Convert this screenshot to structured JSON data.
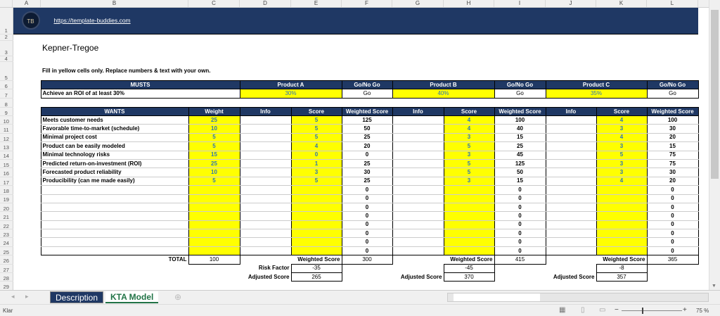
{
  "columns": [
    "A",
    "B",
    "C",
    "D",
    "E",
    "F",
    "G",
    "H",
    "I",
    "J",
    "K",
    "L"
  ],
  "header": {
    "link": "https://template-buddies.com",
    "logo_text": "TB"
  },
  "title": "Kepner-Tregoe",
  "note": "Fill in yellow cells only. Replace numbers & text with your own.",
  "musts": {
    "header": "MUSTS",
    "go_label": "Go/No Go",
    "products": [
      "Product A",
      "Product B",
      "Product C"
    ],
    "criterion": "Achieve an ROI of at least 30%",
    "values": [
      "30%",
      "40%",
      "35%"
    ],
    "go": [
      "Go",
      "Go",
      "Go"
    ]
  },
  "wants": {
    "headers": [
      "WANTS",
      "Weight",
      "Info",
      "Score",
      "Weighted Score"
    ],
    "rows": [
      {
        "name": "Meets customer needs",
        "weight": "25",
        "scores": [
          "5",
          "4",
          "4"
        ],
        "weighted": [
          "125",
          "100",
          "100"
        ]
      },
      {
        "name": "Favorable time-to-market (schedule)",
        "weight": "10",
        "scores": [
          "5",
          "4",
          "3"
        ],
        "weighted": [
          "50",
          "40",
          "30"
        ]
      },
      {
        "name": "Minimal project cost",
        "weight": "5",
        "scores": [
          "5",
          "3",
          "4"
        ],
        "weighted": [
          "25",
          "15",
          "20"
        ]
      },
      {
        "name": "Product can be easily modeled",
        "weight": "5",
        "scores": [
          "4",
          "5",
          "3"
        ],
        "weighted": [
          "20",
          "25",
          "15"
        ]
      },
      {
        "name": "Minimal technology risks",
        "weight": "15",
        "scores": [
          "0",
          "3",
          "5"
        ],
        "weighted": [
          "0",
          "45",
          "75"
        ]
      },
      {
        "name": "Predicted return-on-investment (ROI)",
        "weight": "25",
        "scores": [
          "1",
          "5",
          "3"
        ],
        "weighted": [
          "25",
          "125",
          "75"
        ]
      },
      {
        "name": "Forecasted product reliability",
        "weight": "10",
        "scores": [
          "3",
          "5",
          "3"
        ],
        "weighted": [
          "30",
          "50",
          "30"
        ]
      },
      {
        "name": "Producibility (can me made easily)",
        "weight": "5",
        "scores": [
          "5",
          "3",
          "4"
        ],
        "weighted": [
          "25",
          "15",
          "20"
        ]
      },
      {
        "name": "",
        "weight": "",
        "scores": [
          "",
          "",
          ""
        ],
        "weighted": [
          "0",
          "0",
          "0"
        ]
      },
      {
        "name": "",
        "weight": "",
        "scores": [
          "",
          "",
          ""
        ],
        "weighted": [
          "0",
          "0",
          "0"
        ]
      },
      {
        "name": "",
        "weight": "",
        "scores": [
          "",
          "",
          ""
        ],
        "weighted": [
          "0",
          "0",
          "0"
        ]
      },
      {
        "name": "",
        "weight": "",
        "scores": [
          "",
          "",
          ""
        ],
        "weighted": [
          "0",
          "0",
          "0"
        ]
      },
      {
        "name": "",
        "weight": "",
        "scores": [
          "",
          "",
          ""
        ],
        "weighted": [
          "0",
          "0",
          "0"
        ]
      },
      {
        "name": "",
        "weight": "",
        "scores": [
          "",
          "",
          ""
        ],
        "weighted": [
          "0",
          "0",
          "0"
        ]
      },
      {
        "name": "",
        "weight": "",
        "scores": [
          "",
          "",
          ""
        ],
        "weighted": [
          "0",
          "0",
          "0"
        ]
      },
      {
        "name": "",
        "weight": "",
        "scores": [
          "",
          "",
          ""
        ],
        "weighted": [
          "0",
          "0",
          "0"
        ]
      }
    ]
  },
  "totals": {
    "total_label": "TOTAL",
    "total": "100",
    "ws_label": "Weighted Score",
    "rf_label": "Risk Factor",
    "adj_label": "Adjusted Score",
    "weighted": [
      "300",
      "415",
      "365"
    ],
    "risk": [
      "-35",
      "-45",
      "-8"
    ],
    "adjusted": [
      "265",
      "370",
      "357"
    ]
  },
  "sheets": [
    {
      "label": "Description",
      "active": false
    },
    {
      "label": "KTA Model",
      "active": true
    }
  ],
  "status": {
    "text": "Klar",
    "zoom": "75 %"
  },
  "colors": {
    "navy": "#1f3864",
    "yellow": "#ffff00",
    "score_text": "#2e75b6"
  }
}
